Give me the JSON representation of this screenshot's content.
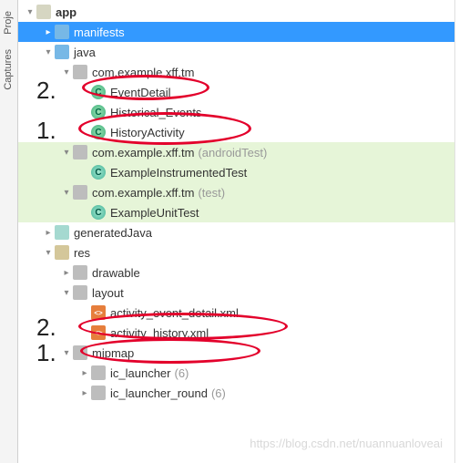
{
  "sidebar": {
    "tabs": [
      "Proje",
      "Captures"
    ]
  },
  "tree": {
    "app": "app",
    "manifests": "manifests",
    "java": "java",
    "pkg_main": "com.example.xff.tm",
    "class_event_detail": "EventDetail",
    "class_historical": "Historical_Events",
    "class_history": "HistoryActivity",
    "pkg_android_test": "com.example.xff.tm",
    "pkg_android_test_suffix": "(androidTest)",
    "class_instr_test": "ExampleInstrumentedTest",
    "pkg_test": "com.example.xff.tm",
    "pkg_test_suffix": "(test)",
    "class_unit_test": "ExampleUnitTest",
    "generated_java": "generatedJava",
    "res": "res",
    "drawable": "drawable",
    "layout": "layout",
    "xml_event_detail": "activity_event_detail.xml",
    "xml_history": "activity_history.xml",
    "mipmap": "mipmap",
    "ic_launcher": "ic_launcher",
    "ic_launcher_count": "(6)",
    "ic_launcher_round": "ic_launcher_round",
    "ic_launcher_round_count": "(6)"
  },
  "annotations": {
    "one": "1.",
    "two": "2."
  },
  "watermark": "https://blog.csdn.net/nuannuanloveai"
}
